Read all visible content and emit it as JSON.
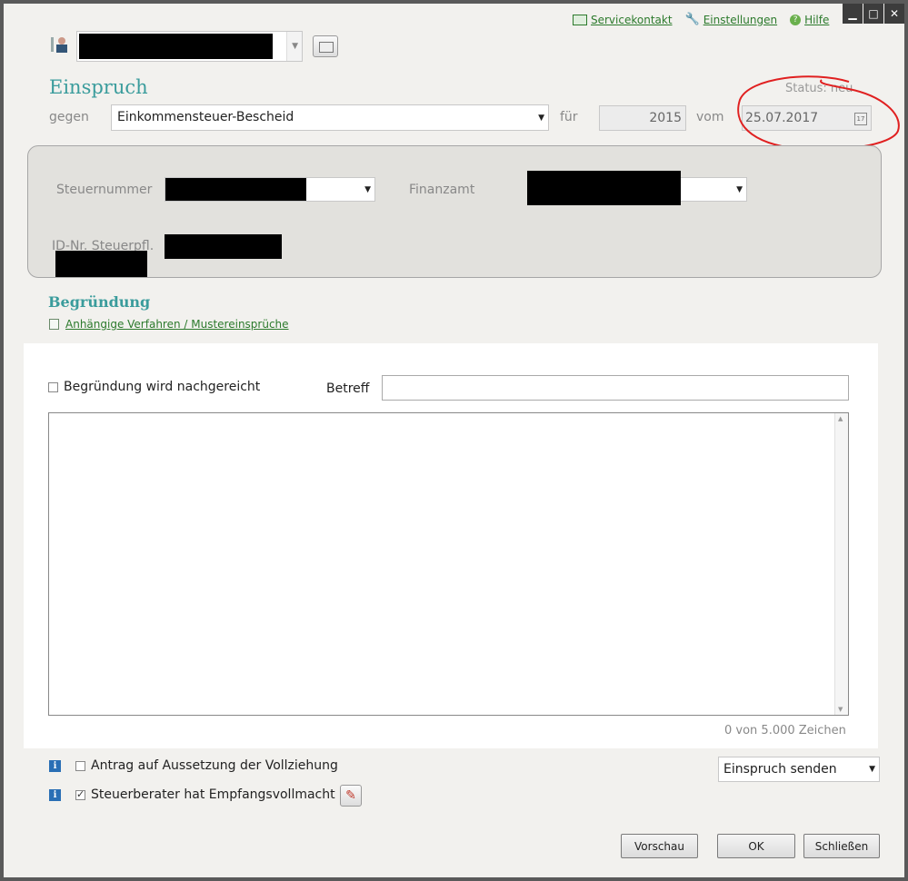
{
  "toplinks": {
    "service": "Servicekontakt",
    "settings": "Einstellungen",
    "help": "Hilfe"
  },
  "window_buttons": {
    "minimize": "▁",
    "maximize": "□",
    "close": "✕"
  },
  "header": {
    "title": "Einspruch",
    "status": "Status: neu",
    "gegen_label": "gegen",
    "gegen_value": "Einkommensteuer-Bescheid",
    "fuer_label": "für",
    "year": "2015",
    "vom_label": "vom",
    "date": "25.07.2017"
  },
  "panel": {
    "steuernummer_label": "Steuernummer",
    "finanzamt_label": "Finanzamt",
    "idnr_label": "ID-Nr. Steuerpfl."
  },
  "begruendung": {
    "title": "Begründung",
    "link": "Anhängige Verfahren / Mustereinsprüche",
    "nachgereicht_label": "Begründung wird nachgereicht",
    "betreff_label": "Betreff",
    "betreff_value": "",
    "counter": "0 von 5.000 Zeichen"
  },
  "options": {
    "aussetzung_label": "Antrag auf Aussetzung der Vollziehung",
    "vollmacht_label": "Steuerberater hat Empfangsvollmacht",
    "action_value": "Einspruch senden"
  },
  "buttons": {
    "preview": "Vorschau",
    "ok": "OK",
    "close": "Schließen"
  },
  "colors": {
    "accent": "#3a9c9c",
    "link": "#2c7a2c",
    "annotation": "#e02020"
  }
}
